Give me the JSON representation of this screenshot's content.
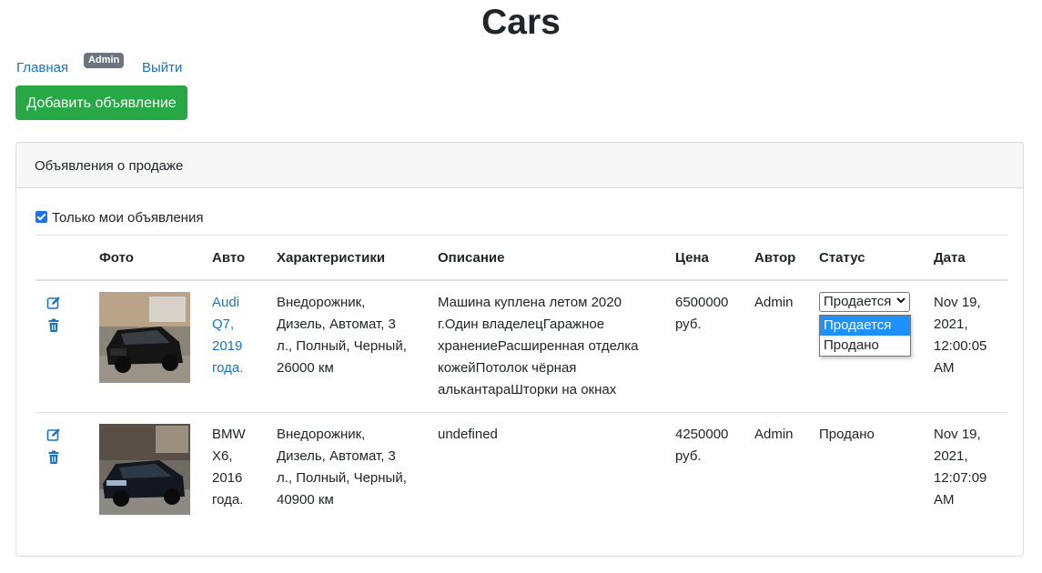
{
  "page": {
    "title": "Cars"
  },
  "nav": {
    "home": "Главная",
    "badge": "Admin",
    "logout": "Выйти"
  },
  "add_button": "Добавить объявление",
  "card": {
    "header": "Объявления о продаже",
    "filter_label": "Только мои объявления",
    "filter_checked": true
  },
  "table": {
    "headers": [
      "Фото",
      "Авто",
      "Характеристики",
      "Описание",
      "Цена",
      "Автор",
      "Статус",
      "Дата"
    ],
    "rows": [
      {
        "auto": [
          "Audi",
          "Q7,",
          "2019",
          "года."
        ],
        "specs": [
          "Внедорожник,",
          "Дизель, Автомат, 3",
          "л., Полный, Черный,",
          "26000 км"
        ],
        "desc": [
          "Машина куплена летом 2020",
          "г.Один владелецГаражное",
          "хранениеРасширенная отделка",
          "кожейПотолок чёрная",
          "алькантараШторки на окнах"
        ],
        "price": [
          "6500000",
          "руб."
        ],
        "author": "Admin",
        "status": "Продается",
        "date": [
          "Nov 19,",
          "2021,",
          "12:00:05",
          "AM"
        ]
      },
      {
        "auto": [
          "BMW",
          "X6,",
          "2016",
          "года."
        ],
        "specs": [
          "Внедорожник,",
          "Дизель, Автомат, 3",
          "л., Полный, Черный,",
          "40900 км"
        ],
        "desc": [
          "undefined"
        ],
        "price": [
          "4250000",
          "руб."
        ],
        "author": "Admin",
        "status": "Продано",
        "date": [
          "Nov 19,",
          "2021,",
          "12:07:09",
          "AM"
        ]
      }
    ]
  },
  "status_dropdown": {
    "selected": "Продается",
    "options": [
      "Продается",
      "Продано"
    ]
  },
  "icons": {
    "edit": "edit-icon",
    "delete": "trash-icon",
    "check": "checkbox-check-icon",
    "chevron": "chevron-down-icon"
  },
  "colors": {
    "accent": "#1a73c8",
    "success": "#28a745",
    "badge": "#6c757d",
    "highlight": "#1e90ff"
  }
}
